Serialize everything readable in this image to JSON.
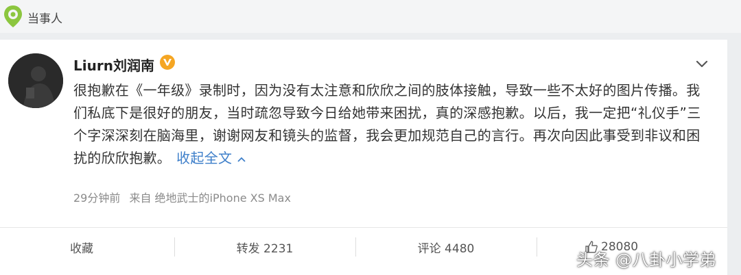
{
  "topic": {
    "icon": "location-pin-icon",
    "label": "当事人"
  },
  "post": {
    "author": "Liurn刘润南",
    "verified_badge": "verified-v-icon",
    "more_icon": "chevron-down-icon",
    "text": "很抱歉在《一年级》录制时，因为没有太注意和欣欣之间的肢体接触，导致一些不太好的图片传播。我们私底下是很好的朋友，当时疏忽导致今日给她带来困扰，真的深感抱歉。以后，我一定把“礼仪手”三个字深深刻在脑海里，谢谢网友和镜头的监督，我会更加规范自己的言行。再次向因此事受到非议和困扰的欣欣抱歉。",
    "collapse_label": "收起全文",
    "time": "29分钟前",
    "source": "来自 绝地武士的iPhone XS Max"
  },
  "actions": {
    "favorite": "收藏",
    "repost": "转发 2231",
    "comment": "评论 4480",
    "like": "28080"
  },
  "watermark": "头条 @八卦小学弟",
  "colors": {
    "link": "#3e7fca",
    "badge": "#f5a623",
    "topic_icon": "#8cc63f"
  }
}
